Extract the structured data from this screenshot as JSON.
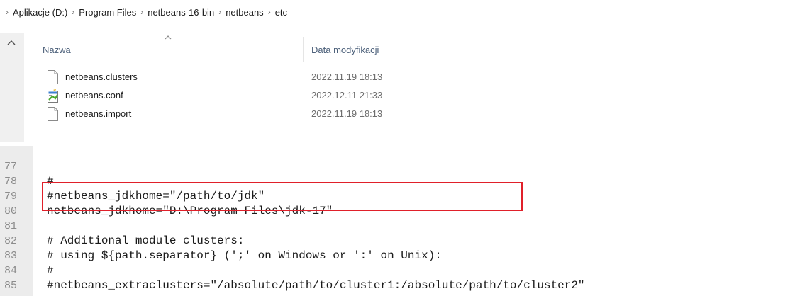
{
  "breadcrumb": {
    "items": [
      "Aplikacje (D:)",
      "Program Files",
      "netbeans-16-bin",
      "netbeans",
      "etc"
    ],
    "separator": "›"
  },
  "file_list": {
    "columns": {
      "name": "Nazwa",
      "date": "Data modyfikacji"
    },
    "files": [
      {
        "name": "netbeans.clusters",
        "date": "2022.11.19 18:13",
        "icon": "text-file-icon"
      },
      {
        "name": "netbeans.conf",
        "date": "2022.12.11 21:33",
        "icon": "config-file-icon"
      },
      {
        "name": "netbeans.import",
        "date": "2022.11.19 18:13",
        "icon": "text-file-icon"
      }
    ]
  },
  "editor": {
    "lines": [
      {
        "num": "77",
        "text": "#"
      },
      {
        "num": "78",
        "text": "#netbeans_jdkhome=\"/path/to/jdk\""
      },
      {
        "num": "79",
        "text": "netbeans_jdkhome=\"D:\\Program Files\\jdk-17\""
      },
      {
        "num": "80",
        "text": ""
      },
      {
        "num": "81",
        "text": "# Additional module clusters:"
      },
      {
        "num": "82",
        "text": "# using ${path.separator} (';' on Windows or ':' on Unix):"
      },
      {
        "num": "83",
        "text": "#"
      },
      {
        "num": "84",
        "text": "#netbeans_extraclusters=\"/absolute/path/to/cluster1:/absolute/path/to/cluster2\""
      },
      {
        "num": "85",
        "text": ""
      }
    ],
    "highlight_color": "#e0202a"
  },
  "colors": {
    "header_text": "#4c607a",
    "date_text": "#6d6d6d",
    "gutter_bg": "#ececec",
    "line_number": "#8c8c8c"
  }
}
